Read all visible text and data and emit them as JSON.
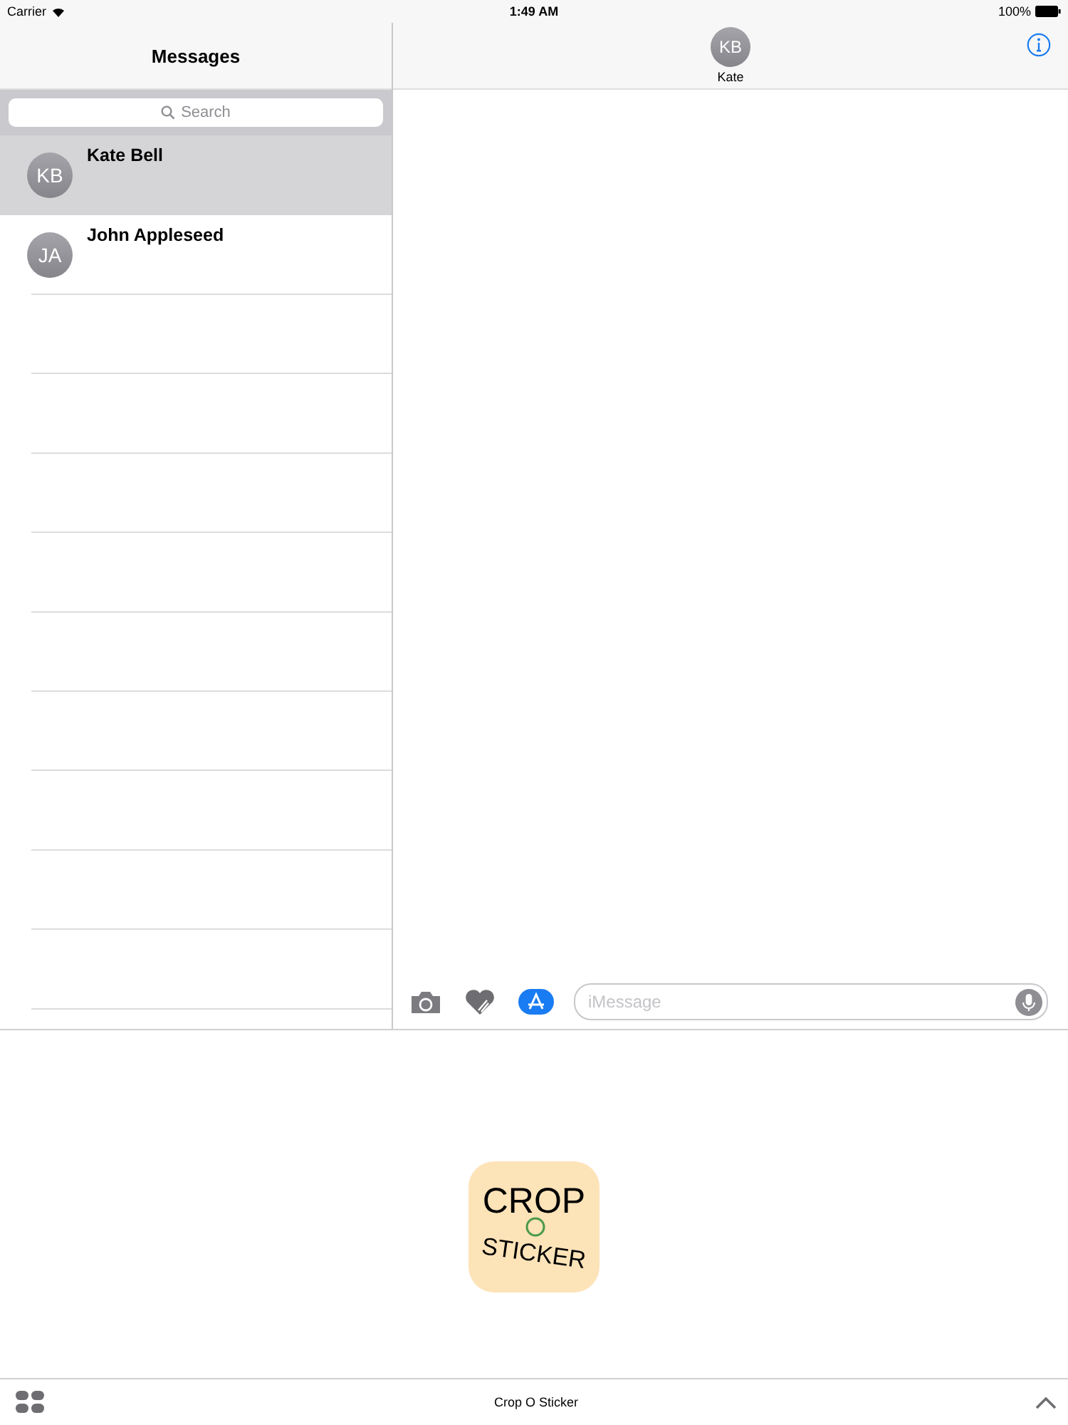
{
  "status_bar": {
    "carrier": "Carrier",
    "time": "1:49 AM",
    "battery": "100%"
  },
  "sidebar": {
    "title": "Messages",
    "search": {
      "placeholder": "Search"
    },
    "conversations": [
      {
        "initials": "KB",
        "name": "Kate Bell",
        "selected": true
      },
      {
        "initials": "JA",
        "name": "John Appleseed",
        "selected": false
      }
    ]
  },
  "conversation": {
    "initials": "KB",
    "name": "Kate",
    "composer": {
      "placeholder": "iMessage"
    }
  },
  "sticker_drawer": {
    "stickers": [
      {
        "line_1": "CROP",
        "line_2": "STICKER"
      }
    ],
    "app_name": "Crop O Sticker"
  }
}
